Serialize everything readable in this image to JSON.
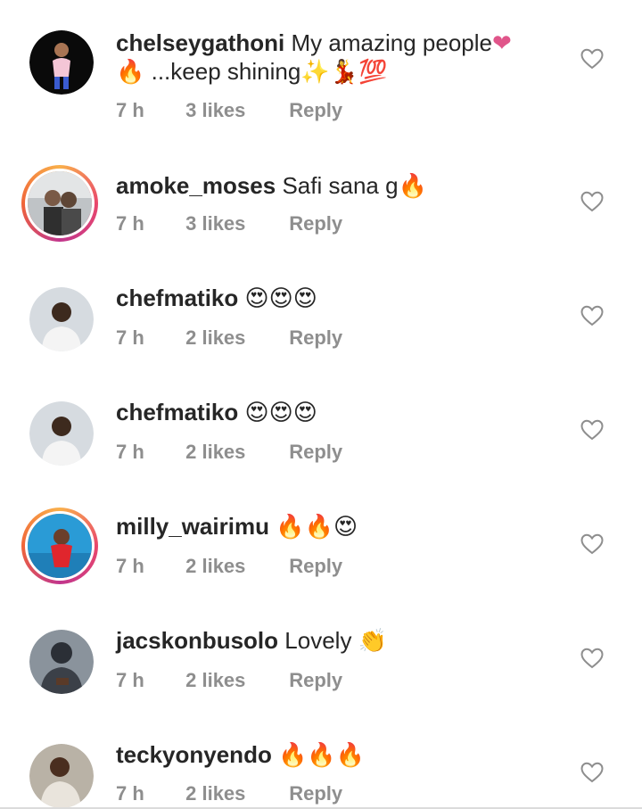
{
  "comments": [
    {
      "username": "chelseygathoni",
      "text_line1": "My amazing people",
      "text_line1_emoji": "❤",
      "text_line2_prefix_emoji": "🔥",
      "text_line2": "...keep shining",
      "text_line2_emoji": "✨💃💯",
      "time": "7 h",
      "likes": "3 likes",
      "reply": "Reply",
      "avatar_icon": "avatar-photo-icon",
      "story_ring": false
    },
    {
      "username": "amoke_moses",
      "text": "Safi sana g",
      "text_emoji": "🔥",
      "time": "7 h",
      "likes": "3 likes",
      "reply": "Reply",
      "avatar_icon": "avatar-photo-icon",
      "story_ring": true
    },
    {
      "username": "chefmatiko",
      "text": "",
      "text_emoji": "😍😍😍",
      "time": "7 h",
      "likes": "2 likes",
      "reply": "Reply",
      "avatar_icon": "avatar-photo-icon",
      "story_ring": false
    },
    {
      "username": "chefmatiko",
      "text": "",
      "text_emoji": "😍😍😍",
      "time": "7 h",
      "likes": "2 likes",
      "reply": "Reply",
      "avatar_icon": "avatar-photo-icon",
      "story_ring": false
    },
    {
      "username": "milly_wairimu",
      "text": "",
      "text_emoji": "🔥🔥😍",
      "time": "7 h",
      "likes": "2 likes",
      "reply": "Reply",
      "avatar_icon": "avatar-photo-icon",
      "story_ring": true
    },
    {
      "username": "jacskonbusolo",
      "text": "Lovely",
      "text_emoji": "👏",
      "time": "7 h",
      "likes": "2 likes",
      "reply": "Reply",
      "avatar_icon": "avatar-photo-icon",
      "story_ring": false
    },
    {
      "username": "teckyonyendo",
      "text": "",
      "text_emoji": "🔥🔥🔥",
      "time": "7 h",
      "likes": "2 likes",
      "reply": "Reply",
      "avatar_icon": "avatar-photo-icon",
      "story_ring": false
    }
  ],
  "icons": {
    "like": "heart-outline-icon"
  },
  "colors": {
    "text": "#262626",
    "meta": "#8e8e8e",
    "story_ring": [
      "#f9b04b",
      "#e9476c",
      "#c1368d"
    ]
  }
}
